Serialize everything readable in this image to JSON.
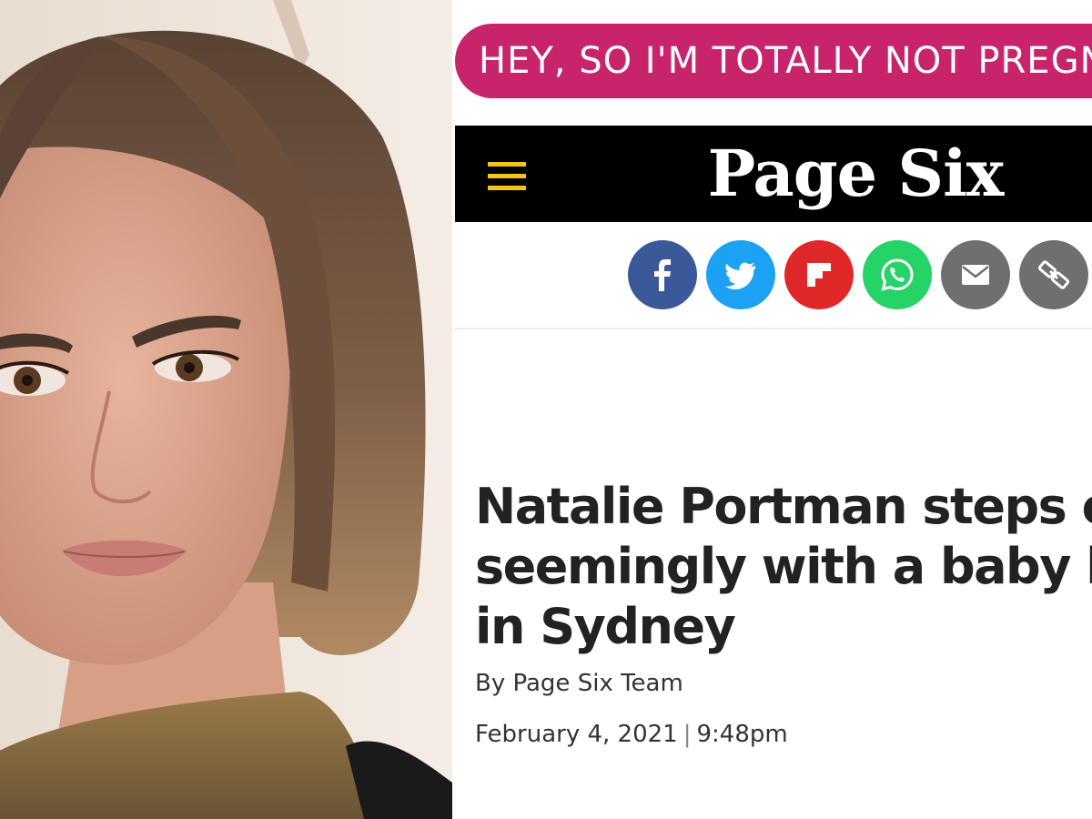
{
  "banner": {
    "text": "HEY, SO I'M TOTALLY NOT PREGNA",
    "color": "#c8246b"
  },
  "nav": {
    "menu_icon": "hamburger-menu-icon",
    "logo_text": "Page Six",
    "accent_color": "#f2c418"
  },
  "share": [
    {
      "name": "facebook-icon",
      "color": "#3b5998"
    },
    {
      "name": "twitter-icon",
      "color": "#1da1f2"
    },
    {
      "name": "flipboard-icon",
      "color": "#e12828"
    },
    {
      "name": "whatsapp-icon",
      "color": "#25d366"
    },
    {
      "name": "email-icon",
      "color": "#6f6f6f"
    },
    {
      "name": "link-icon",
      "color": "#6f6f6f"
    }
  ],
  "article": {
    "headline_lines": [
      "Natalie Portman steps o",
      "seemingly with a baby bu",
      "in Sydney"
    ],
    "byline": "By Page Six Team",
    "date": "February 4, 2021",
    "separator": "|",
    "time": "9:48pm"
  }
}
